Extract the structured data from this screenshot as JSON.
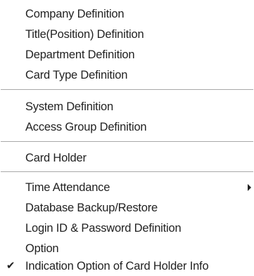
{
  "menu": {
    "items": [
      {
        "label": "Company Definition"
      },
      {
        "label": "Title(Position) Definition"
      },
      {
        "label": "Department Definition"
      },
      {
        "label": "Card Type Definition"
      },
      {
        "label": "System Definition"
      },
      {
        "label": "Access Group Definition"
      },
      {
        "label": "Card Holder"
      },
      {
        "label": "Time Attendance",
        "submenu": true
      },
      {
        "label": "Database Backup/Restore"
      },
      {
        "label": "Login ID & Password Definition"
      },
      {
        "label": "Option"
      },
      {
        "label": "Indication Option of Card Holder Info",
        "checked": true,
        "check_glyph": "✔"
      }
    ]
  }
}
